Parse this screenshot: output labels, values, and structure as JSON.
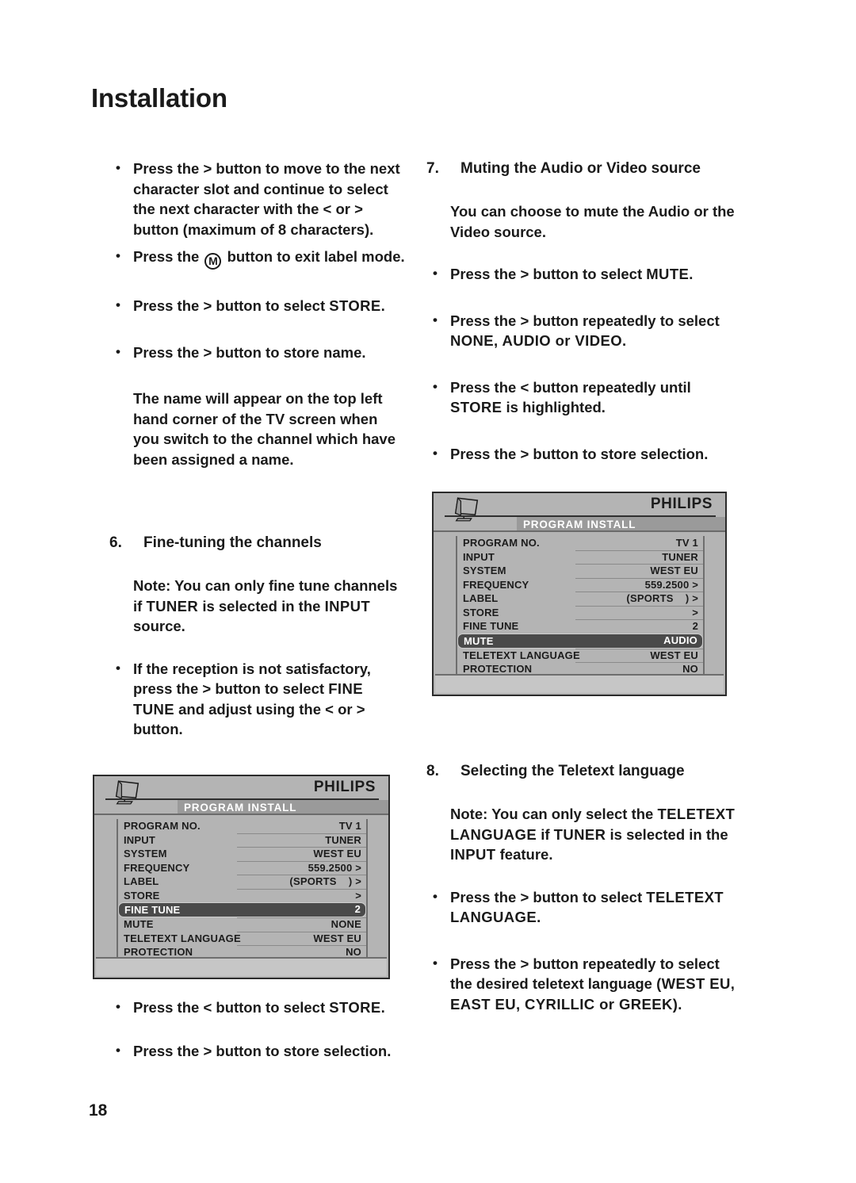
{
  "document": {
    "chapter_title": "Installation",
    "page_number": "18"
  },
  "left_column": {
    "bullet_1": {
      "prefix": "Press the ",
      "arrow": ">",
      "rest": " button to move to the next character slot and continue to select the next character with the ",
      "arrow2": "<",
      "mid": " or ",
      "arrow3": ">",
      "tail": " button (maximum of 8 characters)."
    },
    "bullet_2": {
      "prefix": "Press the ",
      "icon_label": "M",
      "rest": " button to exit label mode."
    },
    "bullet_3": {
      "prefix": "Press the ",
      "arrow": ">",
      "mid": " button to select ",
      "emphasis": "STORE",
      "tail": "."
    },
    "bullet_4": {
      "prefix": "Press the ",
      "arrow": ">",
      "rest": " button to store name."
    },
    "paragraph_1": "The name will appear on the top left hand corner of the TV screen when you switch to the channel which have been assigned a name.",
    "section_6": {
      "number": "6.",
      "title": "Fine-tuning the channels",
      "note": {
        "prefix": "Note: You can only fine tune channels if ",
        "em1": "TUNER",
        "mid": " is selected in the ",
        "em2": "INPUT",
        "tail": " source."
      },
      "bullet": {
        "prefix": "If the reception is not satisfactory, press the ",
        "arrow": ">",
        "mid": " button to select ",
        "em1": "FINE TUNE",
        "mid2": " and adjust using the ",
        "arrow2": "<",
        "mid3": " or ",
        "arrow3": ">",
        "tail": " button."
      }
    },
    "bullet_after_image_1": {
      "prefix": "Press the ",
      "arrow": "<",
      "mid": " button to select ",
      "emphasis": "STORE",
      "tail": "."
    },
    "bullet_after_image_2": {
      "prefix": "Press the ",
      "arrow": ">",
      "rest": " button to store selection."
    }
  },
  "right_column": {
    "section_7": {
      "number": "7.",
      "title": "Muting the Audio or Video source",
      "paragraph": "You can choose to mute the Audio or the Video source.",
      "bullet_1": {
        "prefix": "Press the ",
        "arrow": ">",
        "mid": " button to select ",
        "emphasis": "MUTE",
        "tail": "."
      },
      "bullet_2": {
        "prefix": "Press the ",
        "arrow": ">",
        "mid": " button repeatedly to select ",
        "emphasis": "NONE, AUDIO or VIDEO",
        "tail": "."
      },
      "bullet_3": {
        "prefix": "Press the ",
        "arrow": "<",
        "mid": " button repeatedly until ",
        "emphasis": "STORE",
        "tail": " is highlighted."
      },
      "bullet_4": {
        "prefix": "Press the ",
        "arrow": ">",
        "rest": " button to store selection."
      }
    },
    "section_8": {
      "number": "8.",
      "title": "Selecting the Teletext language",
      "note": {
        "prefix": "Note: You can only select the ",
        "em1": "TELETEXT LANGUAGE",
        "mid": " if ",
        "em2": "TUNER",
        "mid2": " is selected in the ",
        "em3": "INPUT",
        "tail": " feature."
      },
      "bullet_1": {
        "prefix": "Press the ",
        "arrow": ">",
        "mid": " button to select ",
        "emphasis": "TELETEXT LANGUAGE",
        "tail": "."
      },
      "bullet_2": {
        "prefix": "Press the ",
        "arrow": ">",
        "mid": " button repeatedly to select the desired teletext language ",
        "emphasis": "(WEST EU, EAST EU, CYRILLIC or GREEK)",
        "tail": "."
      }
    }
  },
  "osd_left": {
    "brand": "PHILIPS",
    "subtitle": "PROGRAM INSTALL",
    "rows": [
      {
        "label": "PROGRAM NO.",
        "value": "TV 1",
        "highlighted": false
      },
      {
        "label": "INPUT",
        "value": "TUNER",
        "highlighted": false
      },
      {
        "label": "SYSTEM",
        "value": "WEST EU",
        "highlighted": false
      },
      {
        "label": "FREQUENCY",
        "value": "559.2500 >",
        "highlighted": false
      },
      {
        "label": "LABEL",
        "value": "(SPORTS    ) >",
        "highlighted": false
      },
      {
        "label": "STORE",
        "value": ">",
        "highlighted": false
      },
      {
        "label": "FINE TUNE",
        "value": "2",
        "highlighted": true
      },
      {
        "label": "MUTE",
        "value": "NONE",
        "highlighted": false
      },
      {
        "label": "TELETEXT LANGUAGE",
        "value": "WEST EU",
        "highlighted": false
      },
      {
        "label": "PROTECTION",
        "value": "NO",
        "highlighted": false
      }
    ]
  },
  "osd_right": {
    "brand": "PHILIPS",
    "subtitle": "PROGRAM INSTALL",
    "rows": [
      {
        "label": "PROGRAM NO.",
        "value": "TV 1",
        "highlighted": false
      },
      {
        "label": "INPUT",
        "value": "TUNER",
        "highlighted": false
      },
      {
        "label": "SYSTEM",
        "value": "WEST EU",
        "highlighted": false
      },
      {
        "label": "FREQUENCY",
        "value": "559.2500 >",
        "highlighted": false
      },
      {
        "label": "LABEL",
        "value": "(SPORTS    ) >",
        "highlighted": false
      },
      {
        "label": "STORE",
        "value": ">",
        "highlighted": false
      },
      {
        "label": "FINE TUNE",
        "value": "2",
        "highlighted": false
      },
      {
        "label": "MUTE",
        "value": "AUDIO",
        "highlighted": true
      },
      {
        "label": "TELETEXT LANGUAGE",
        "value": "WEST EU",
        "highlighted": false
      },
      {
        "label": "PROTECTION",
        "value": "NO",
        "highlighted": false
      }
    ]
  },
  "colors": {
    "osd_background": "#b4b4b4",
    "osd_highlight": "#4a4a4a",
    "osd_subtitle_bar": "#9a9a9a",
    "text": "#1a1a1a"
  }
}
